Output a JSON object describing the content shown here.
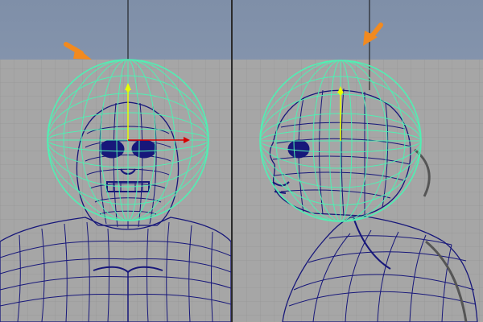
{
  "viewports": [
    {
      "id": "front",
      "view": "front"
    },
    {
      "id": "side",
      "view": "side"
    }
  ],
  "colors": {
    "viewport_background_blue": "#8b9bb3",
    "reference_plane_gray": "#a6a6a6",
    "grid_line": "#8f8f8f",
    "mesh_wireframe": "#17177a",
    "selected_sphere": "#4ff0b3",
    "annotation_arrow": "#f28a1f",
    "manipulator_yellow": "#e6ff00",
    "manipulator_red": "#d80000"
  },
  "annotations": [
    {
      "type": "arrow",
      "color": "#f28a1f",
      "viewport": "front",
      "direction": "down-right"
    },
    {
      "type": "arrow",
      "color": "#f28a1f",
      "viewport": "side",
      "direction": "down-left"
    }
  ],
  "selection": {
    "object": "wireframe-sphere",
    "highlight_color": "#4ff0b3"
  }
}
